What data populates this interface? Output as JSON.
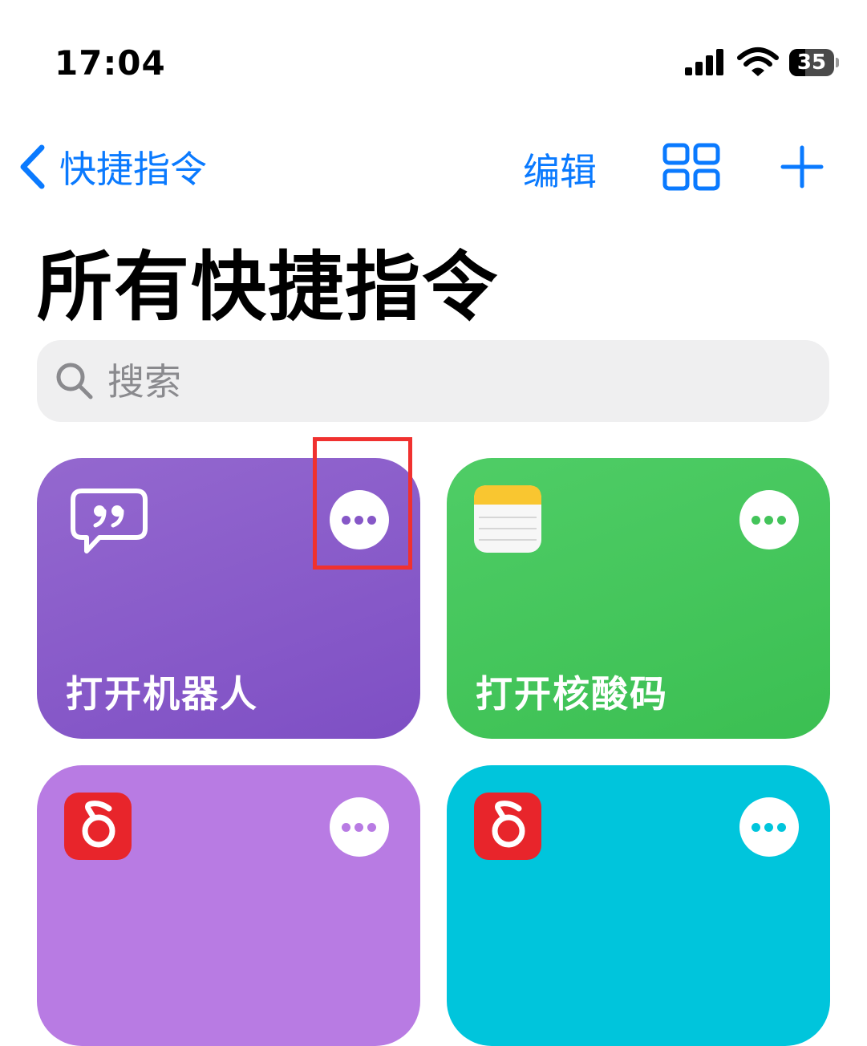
{
  "status_bar": {
    "time": "17:04",
    "battery": "35",
    "battery_level": 0.35
  },
  "nav": {
    "back_label": "快捷指令",
    "edit_label": "编辑"
  },
  "page_title": "所有快捷指令",
  "search": {
    "placeholder": "搜索",
    "value": ""
  },
  "colors": {
    "accent": "#0a7aff",
    "highlight": "#f0312f",
    "card_purple": "#8657c7",
    "card_green": "#43c45a",
    "card_lilac": "#b87be3",
    "card_cyan": "#00c5dc"
  },
  "shortcuts": [
    {
      "name": "打开机器人",
      "icon": "quote-bubble-icon"
    },
    {
      "name": "打开核酸码",
      "icon": "notes-app-icon"
    },
    {
      "name": "",
      "icon": "netease-music-icon"
    },
    {
      "name": "",
      "icon": "netease-music-icon"
    }
  ]
}
